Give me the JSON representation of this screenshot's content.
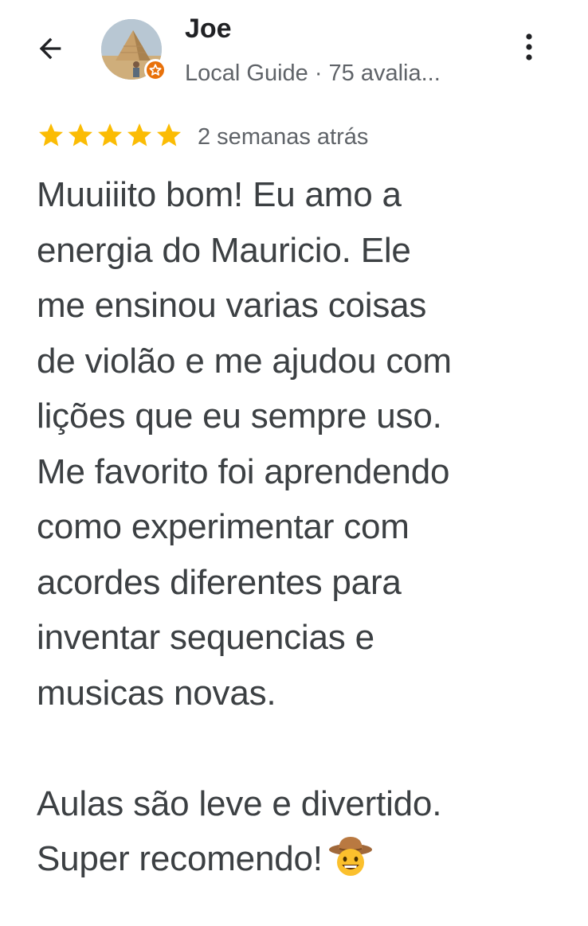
{
  "review": {
    "author": {
      "name": "Joe",
      "meta": "Local Guide · 75 avalia..."
    },
    "rating": 5,
    "date": "2 semanas atrás",
    "body": "Muuiiito bom! Eu amo a\nenergia do Mauricio. Ele\nme ensinou varias coisas\nde violão e me ajudou com\nlições que eu sempre uso.\nMe favorito foi aprendendo\ncomo experimentar com\nacordes diferentes para\ninventar sequencias e\nmusicas novas.\n\nAulas são leve e divertido.\nSuper recomendo!",
    "trailing_emoji": "cowboy-hat-face-icon"
  },
  "icons": {
    "back": "arrow-back-icon",
    "more": "more-vert-icon",
    "badge": "local-guide-badge-icon",
    "star": "star-icon"
  },
  "colors": {
    "star": "#fbbc04",
    "badge": "#e8710a",
    "text_primary": "#202124",
    "text_body": "#3c4043",
    "text_secondary": "#5f6368"
  }
}
